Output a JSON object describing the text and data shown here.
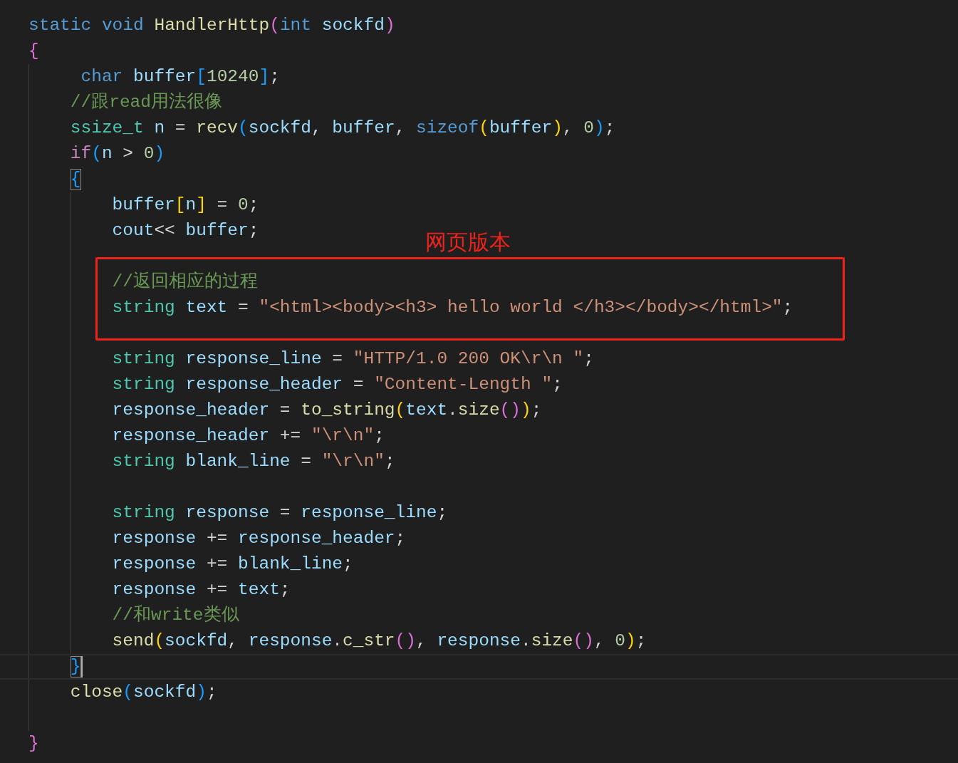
{
  "code": [
    {
      "kind": "line",
      "current": false,
      "tokens": [
        {
          "text": "static",
          "kind": "kw"
        },
        {
          "text": " void",
          "kind": "kw"
        },
        {
          "text": " HandlerHttp",
          "kind": "fn"
        },
        {
          "text": "(",
          "kind": "b2"
        },
        {
          "text": "int",
          "kind": "kw"
        },
        {
          "text": " sockfd",
          "kind": "var"
        },
        {
          "text": ")",
          "kind": "b2"
        }
      ]
    },
    {
      "kind": "line",
      "current": false,
      "tokens": [
        {
          "text": "{",
          "kind": "b2"
        }
      ]
    },
    {
      "kind": "block",
      "children": [
        {
          "kind": "line",
          "current": false,
          "tokens": [
            {
              "text": " char",
              "kind": "kw"
            },
            {
              "text": " buffer",
              "kind": "var"
            },
            {
              "text": "[",
              "kind": "b3"
            },
            {
              "text": "10240",
              "kind": "num"
            },
            {
              "text": "]",
              "kind": "b3"
            },
            {
              "text": ";",
              "kind": "op"
            }
          ]
        },
        {
          "kind": "line",
          "current": false,
          "tokens": [
            {
              "text": "//跟read用法很像",
              "kind": "cmt"
            }
          ]
        },
        {
          "kind": "line",
          "current": false,
          "tokens": [
            {
              "text": "ssize_t",
              "kind": "type"
            },
            {
              "text": " n",
              "kind": "var"
            },
            {
              "text": " =",
              "kind": "op"
            },
            {
              "text": " recv",
              "kind": "fn"
            },
            {
              "text": "(",
              "kind": "b3"
            },
            {
              "text": "sockfd",
              "kind": "var"
            },
            {
              "text": ",",
              "kind": "op"
            },
            {
              "text": " buffer",
              "kind": "var"
            },
            {
              "text": ",",
              "kind": "op"
            },
            {
              "text": " sizeof",
              "kind": "kw"
            },
            {
              "text": "(",
              "kind": "b1"
            },
            {
              "text": "buffer",
              "kind": "var"
            },
            {
              "text": ")",
              "kind": "b1"
            },
            {
              "text": ",",
              "kind": "op"
            },
            {
              "text": " 0",
              "kind": "num"
            },
            {
              "text": ")",
              "kind": "b3"
            },
            {
              "text": ";",
              "kind": "op"
            }
          ]
        },
        {
          "kind": "line",
          "current": false,
          "tokens": [
            {
              "text": "if",
              "kind": "ctrl"
            },
            {
              "text": "(",
              "kind": "b3"
            },
            {
              "text": "n",
              "kind": "var"
            },
            {
              "text": " >",
              "kind": "op"
            },
            {
              "text": " 0",
              "kind": "num"
            },
            {
              "text": ")",
              "kind": "b3"
            }
          ]
        },
        {
          "kind": "line",
          "current": false,
          "tokens": [
            {
              "text": "{",
              "kind": "b3",
              "matched": true
            }
          ]
        },
        {
          "kind": "block",
          "children": [
            {
              "kind": "line",
              "current": false,
              "tokens": [
                {
                  "text": "buffer",
                  "kind": "var"
                },
                {
                  "text": "[",
                  "kind": "b1"
                },
                {
                  "text": "n",
                  "kind": "var"
                },
                {
                  "text": "]",
                  "kind": "b1"
                },
                {
                  "text": " =",
                  "kind": "op"
                },
                {
                  "text": " 0",
                  "kind": "num"
                },
                {
                  "text": ";",
                  "kind": "op"
                }
              ]
            },
            {
              "kind": "line",
              "current": false,
              "tokens": [
                {
                  "text": "cout",
                  "kind": "var"
                },
                {
                  "text": "<<",
                  "kind": "op"
                },
                {
                  "text": " buffer",
                  "kind": "var"
                },
                {
                  "text": ";",
                  "kind": "op"
                }
              ]
            },
            {
              "kind": "boxed",
              "label": "网页版本",
              "children": [
                {
                  "kind": "line",
                  "current": false,
                  "tokens": [
                    {
                      "text": "//返回相应的过程",
                      "kind": "cmt"
                    }
                  ]
                },
                {
                  "kind": "line",
                  "current": false,
                  "tokens": [
                    {
                      "text": "string",
                      "kind": "type"
                    },
                    {
                      "text": " text",
                      "kind": "var"
                    },
                    {
                      "text": " =",
                      "kind": "op"
                    },
                    {
                      "text": " \"<html><body><h3> hello world </h3></body></html>\"",
                      "kind": "str"
                    },
                    {
                      "text": ";",
                      "kind": "op"
                    }
                  ]
                }
              ]
            },
            {
              "kind": "line",
              "current": false,
              "tokens": [
                {
                  "text": "string",
                  "kind": "type"
                },
                {
                  "text": " response_line",
                  "kind": "var"
                },
                {
                  "text": " =",
                  "kind": "op"
                },
                {
                  "text": " \"HTTP/1.0 200 OK\\r\\n \"",
                  "kind": "str"
                },
                {
                  "text": ";",
                  "kind": "op"
                }
              ]
            },
            {
              "kind": "line",
              "current": false,
              "tokens": [
                {
                  "text": "string",
                  "kind": "type"
                },
                {
                  "text": " response_header",
                  "kind": "var"
                },
                {
                  "text": " =",
                  "kind": "op"
                },
                {
                  "text": " \"Content-Length \"",
                  "kind": "str"
                },
                {
                  "text": ";",
                  "kind": "op"
                }
              ]
            },
            {
              "kind": "line",
              "current": false,
              "tokens": [
                {
                  "text": "response_header",
                  "kind": "var"
                },
                {
                  "text": " =",
                  "kind": "op"
                },
                {
                  "text": " to_string",
                  "kind": "fn"
                },
                {
                  "text": "(",
                  "kind": "b1"
                },
                {
                  "text": "text",
                  "kind": "var"
                },
                {
                  "text": ".",
                  "kind": "op"
                },
                {
                  "text": "size",
                  "kind": "fn"
                },
                {
                  "text": "(",
                  "kind": "b2"
                },
                {
                  "text": ")",
                  "kind": "b2"
                },
                {
                  "text": ")",
                  "kind": "b1"
                },
                {
                  "text": ";",
                  "kind": "op"
                }
              ]
            },
            {
              "kind": "line",
              "current": false,
              "tokens": [
                {
                  "text": "response_header",
                  "kind": "var"
                },
                {
                  "text": " +=",
                  "kind": "op"
                },
                {
                  "text": " \"\\r\\n\"",
                  "kind": "str"
                },
                {
                  "text": ";",
                  "kind": "op"
                }
              ]
            },
            {
              "kind": "line",
              "current": false,
              "tokens": [
                {
                  "text": "string",
                  "kind": "type"
                },
                {
                  "text": " blank_line",
                  "kind": "var"
                },
                {
                  "text": " =",
                  "kind": "op"
                },
                {
                  "text": " \"\\r\\n\"",
                  "kind": "str"
                },
                {
                  "text": ";",
                  "kind": "op"
                }
              ]
            },
            {
              "kind": "line",
              "current": false
            },
            {
              "kind": "line",
              "current": false,
              "tokens": [
                {
                  "text": "string",
                  "kind": "type"
                },
                {
                  "text": " response",
                  "kind": "var"
                },
                {
                  "text": " =",
                  "kind": "op"
                },
                {
                  "text": " response_line",
                  "kind": "var"
                },
                {
                  "text": ";",
                  "kind": "op"
                }
              ]
            },
            {
              "kind": "line",
              "current": false,
              "tokens": [
                {
                  "text": "response",
                  "kind": "var"
                },
                {
                  "text": " +=",
                  "kind": "op"
                },
                {
                  "text": " response_header",
                  "kind": "var"
                },
                {
                  "text": ";",
                  "kind": "op"
                }
              ]
            },
            {
              "kind": "line",
              "current": false,
              "tokens": [
                {
                  "text": "response",
                  "kind": "var"
                },
                {
                  "text": " +=",
                  "kind": "op"
                },
                {
                  "text": " blank_line",
                  "kind": "var"
                },
                {
                  "text": ";",
                  "kind": "op"
                }
              ]
            },
            {
              "kind": "line",
              "current": false,
              "tokens": [
                {
                  "text": "response",
                  "kind": "var"
                },
                {
                  "text": " +=",
                  "kind": "op"
                },
                {
                  "text": " text",
                  "kind": "var"
                },
                {
                  "text": ";",
                  "kind": "op"
                }
              ]
            },
            {
              "kind": "line",
              "current": false,
              "tokens": [
                {
                  "text": "//和write类似",
                  "kind": "cmt"
                }
              ]
            },
            {
              "kind": "line",
              "current": false,
              "tokens": [
                {
                  "text": "send",
                  "kind": "fn"
                },
                {
                  "text": "(",
                  "kind": "b1"
                },
                {
                  "text": "sockfd",
                  "kind": "var"
                },
                {
                  "text": ",",
                  "kind": "op"
                },
                {
                  "text": " response",
                  "kind": "var"
                },
                {
                  "text": ".",
                  "kind": "op"
                },
                {
                  "text": "c_str",
                  "kind": "fn"
                },
                {
                  "text": "(",
                  "kind": "b2"
                },
                {
                  "text": ")",
                  "kind": "b2"
                },
                {
                  "text": ",",
                  "kind": "op"
                },
                {
                  "text": " response",
                  "kind": "var"
                },
                {
                  "text": ".",
                  "kind": "op"
                },
                {
                  "text": "size",
                  "kind": "fn"
                },
                {
                  "text": "(",
                  "kind": "b2"
                },
                {
                  "text": ")",
                  "kind": "b2"
                },
                {
                  "text": ",",
                  "kind": "op"
                },
                {
                  "text": " 0",
                  "kind": "num"
                },
                {
                  "text": ")",
                  "kind": "b1"
                },
                {
                  "text": ";",
                  "kind": "op"
                }
              ]
            }
          ]
        },
        {
          "kind": "line",
          "current": true,
          "tokens": [
            {
              "text": "}",
              "kind": "b3",
              "matched": true
            }
          ]
        },
        {
          "kind": "line",
          "current": false,
          "tokens": [
            {
              "text": "close",
              "kind": "fn"
            },
            {
              "text": "(",
              "kind": "b3"
            },
            {
              "text": "sockfd",
              "kind": "var"
            },
            {
              "text": ")",
              "kind": "b3"
            },
            {
              "text": ";",
              "kind": "op"
            }
          ]
        },
        {
          "kind": "line",
          "current": false
        }
      ]
    },
    {
      "kind": "line",
      "current": false,
      "tokens": [
        {
          "text": "}",
          "kind": "b2"
        }
      ]
    }
  ]
}
